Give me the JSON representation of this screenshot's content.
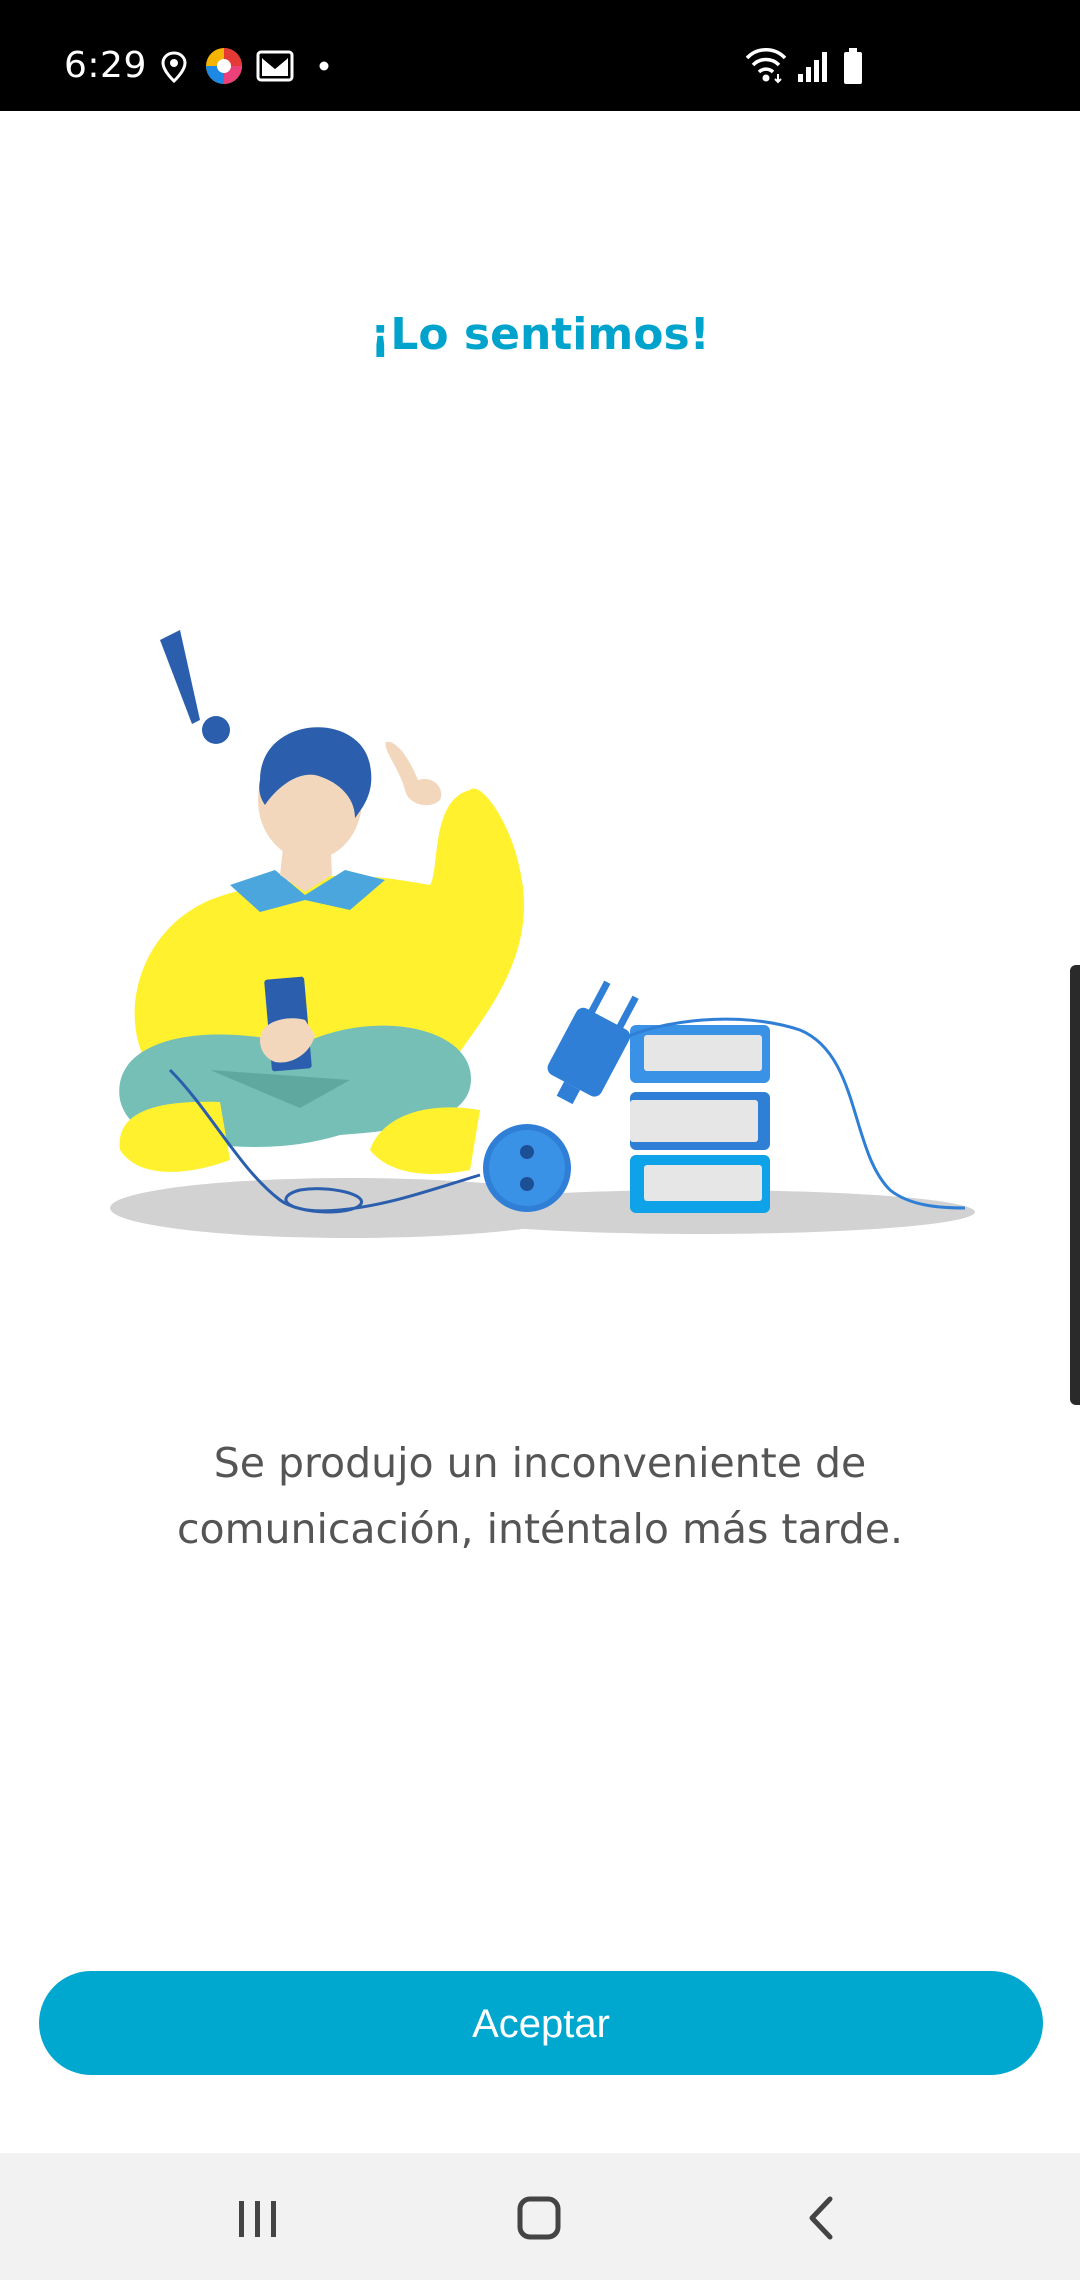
{
  "status_bar": {
    "time": "6:29",
    "icons_left": [
      "location-icon",
      "browser-app-icon",
      "mail-icon",
      "dot-icon"
    ],
    "icons_right": [
      "wifi-icon",
      "signal-icon",
      "battery-icon"
    ]
  },
  "dialog": {
    "title": "¡Lo sentimos!",
    "message_line1": "Se produjo un inconveniente de",
    "message_line2": "comunicación, inténtalo más tarde.",
    "accept_label": "Aceptar"
  },
  "colors": {
    "accent": "#00a8d0",
    "title": "#00a3cc",
    "message": "#555555",
    "status_bar": "#000000",
    "nav_bar": "#f2f2f2"
  },
  "nav_bar": {
    "buttons": [
      "recent-apps-icon",
      "home-icon",
      "back-icon"
    ]
  }
}
